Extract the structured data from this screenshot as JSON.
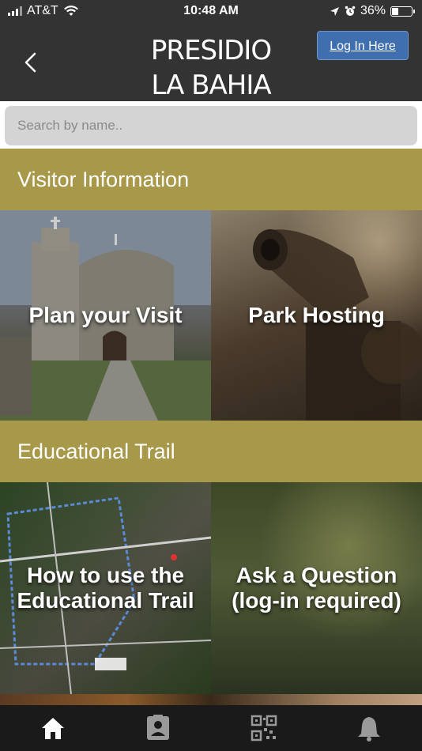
{
  "status_bar": {
    "carrier": "AT&T",
    "time": "10:48 AM",
    "battery": "36%",
    "battery_level": 0.36,
    "icons": [
      "signal-icon",
      "wifi-icon",
      "location-arrow-icon",
      "alarm-icon",
      "battery-icon"
    ]
  },
  "header": {
    "title_line1": "PRESIDIO",
    "title_line2": "LA BAHIA",
    "login_label": "Log In Here",
    "back_icon": "chevron-left-icon"
  },
  "search": {
    "placeholder": "Search by name.."
  },
  "sections": [
    {
      "title": "Visitor Information",
      "tiles": [
        {
          "label": "Plan your Visit"
        },
        {
          "label": "Park Hosting"
        }
      ]
    },
    {
      "title": "Educational Trail",
      "tiles": [
        {
          "label_line1": "How to use the",
          "label_line2": "Educational Trail"
        },
        {
          "label_line1": "Ask a Question",
          "label_line2": "(log-in required)"
        }
      ]
    }
  ],
  "tab_bar": {
    "tabs": [
      "home-icon",
      "contact-card-icon",
      "qr-code-icon",
      "bell-icon"
    ],
    "active_color": "#ffffff",
    "inactive_color": "#9a9a9a"
  },
  "colors": {
    "header_bg": "#333333",
    "section_bg": "#a8984a",
    "login_button": "#3f6fae"
  }
}
